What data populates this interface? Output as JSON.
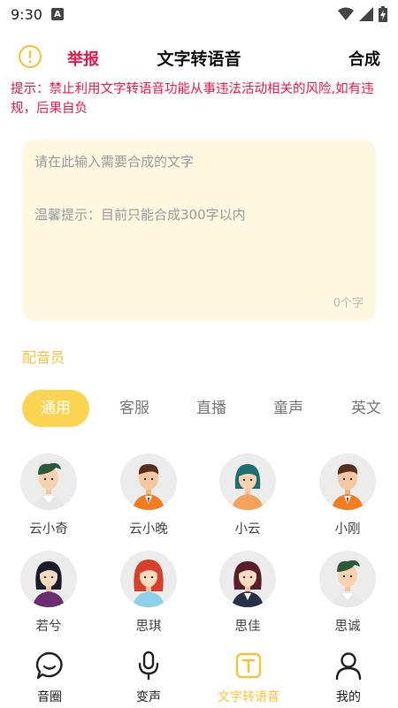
{
  "status": {
    "time": "9:30",
    "badge": "A"
  },
  "header": {
    "report_label": "举报",
    "title": "文字转语音",
    "compose_label": "合成"
  },
  "warning": "提示：禁止利用文字转语音功能从事违法活动相关的风险,如有违规，后果自负",
  "input": {
    "placeholder": "请在此输入需要合成的文字",
    "tip": "温馨提示：目前只能合成300字以内",
    "count": "0个字"
  },
  "voice_section_label": "配音员",
  "tabs": [
    "通用",
    "客服",
    "直播",
    "童声",
    "英文"
  ],
  "voices": [
    {
      "name": "云小奇",
      "avatar": "man-avatar-icon"
    },
    {
      "name": "云小晚",
      "avatar": "man-avatar-icon"
    },
    {
      "name": "小云",
      "avatar": "woman-avatar-icon"
    },
    {
      "name": "小刚",
      "avatar": "man-avatar-icon"
    },
    {
      "name": "若兮",
      "avatar": "woman-avatar-icon"
    },
    {
      "name": "思琪",
      "avatar": "woman-avatar-icon"
    },
    {
      "name": "思佳",
      "avatar": "woman-avatar-icon"
    },
    {
      "name": "思诚",
      "avatar": "man-avatar-icon"
    }
  ],
  "nav": [
    {
      "label": "音圈",
      "icon": "chat-bubble-icon"
    },
    {
      "label": "变声",
      "icon": "microphone-icon"
    },
    {
      "label": "文字转语音",
      "icon": "text-icon"
    },
    {
      "label": "我的",
      "icon": "person-icon"
    }
  ],
  "colors": {
    "accent": "#fbd451",
    "accent_text": "#f9c23c",
    "warning": "#f0164b",
    "input_bg": "#fff8e1"
  }
}
